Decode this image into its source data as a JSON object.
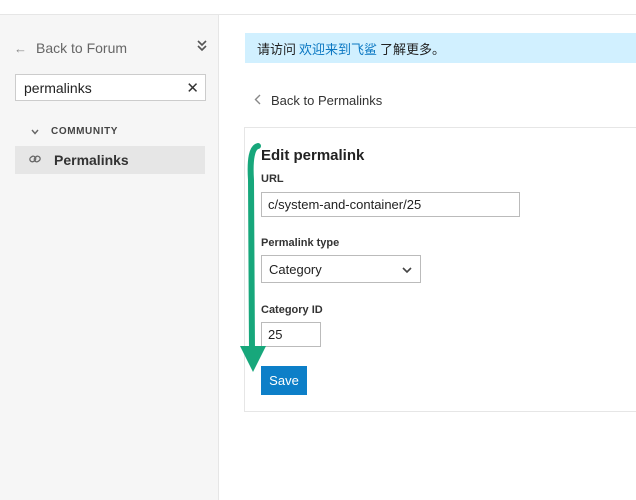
{
  "colors": {
    "accent": "#0d7fc8",
    "notice_bg": "#d1f0ff",
    "link": "#0a77c2",
    "annotation_arrow": "#17a77b",
    "sidebar_bg": "#f6f6f6"
  },
  "sidebar": {
    "back_label": "Back to Forum",
    "back_icon": "arrow-left-icon",
    "collapse_icon": "double-chevron-icon",
    "search": {
      "value": "permalinks",
      "clear_icon": "close-icon"
    },
    "section": {
      "label": "COMMUNITY",
      "icon": "chevron-down-icon"
    },
    "items": [
      {
        "label": "Permalinks",
        "icon": "link-icon",
        "active": true
      }
    ]
  },
  "notice": {
    "prefix": "请访问",
    "link_text": "欢迎来到飞鲨",
    "suffix": "了解更多。"
  },
  "breadcrumb": {
    "label": "Back to Permalinks",
    "icon": "chevron-left-icon"
  },
  "form": {
    "title": "Edit permalink",
    "url_label": "URL",
    "url_value": "c/system-and-container/25",
    "type_label": "Permalink type",
    "type_value": "Category",
    "category_label": "Category ID",
    "category_value": "25",
    "save_label": "Save"
  }
}
